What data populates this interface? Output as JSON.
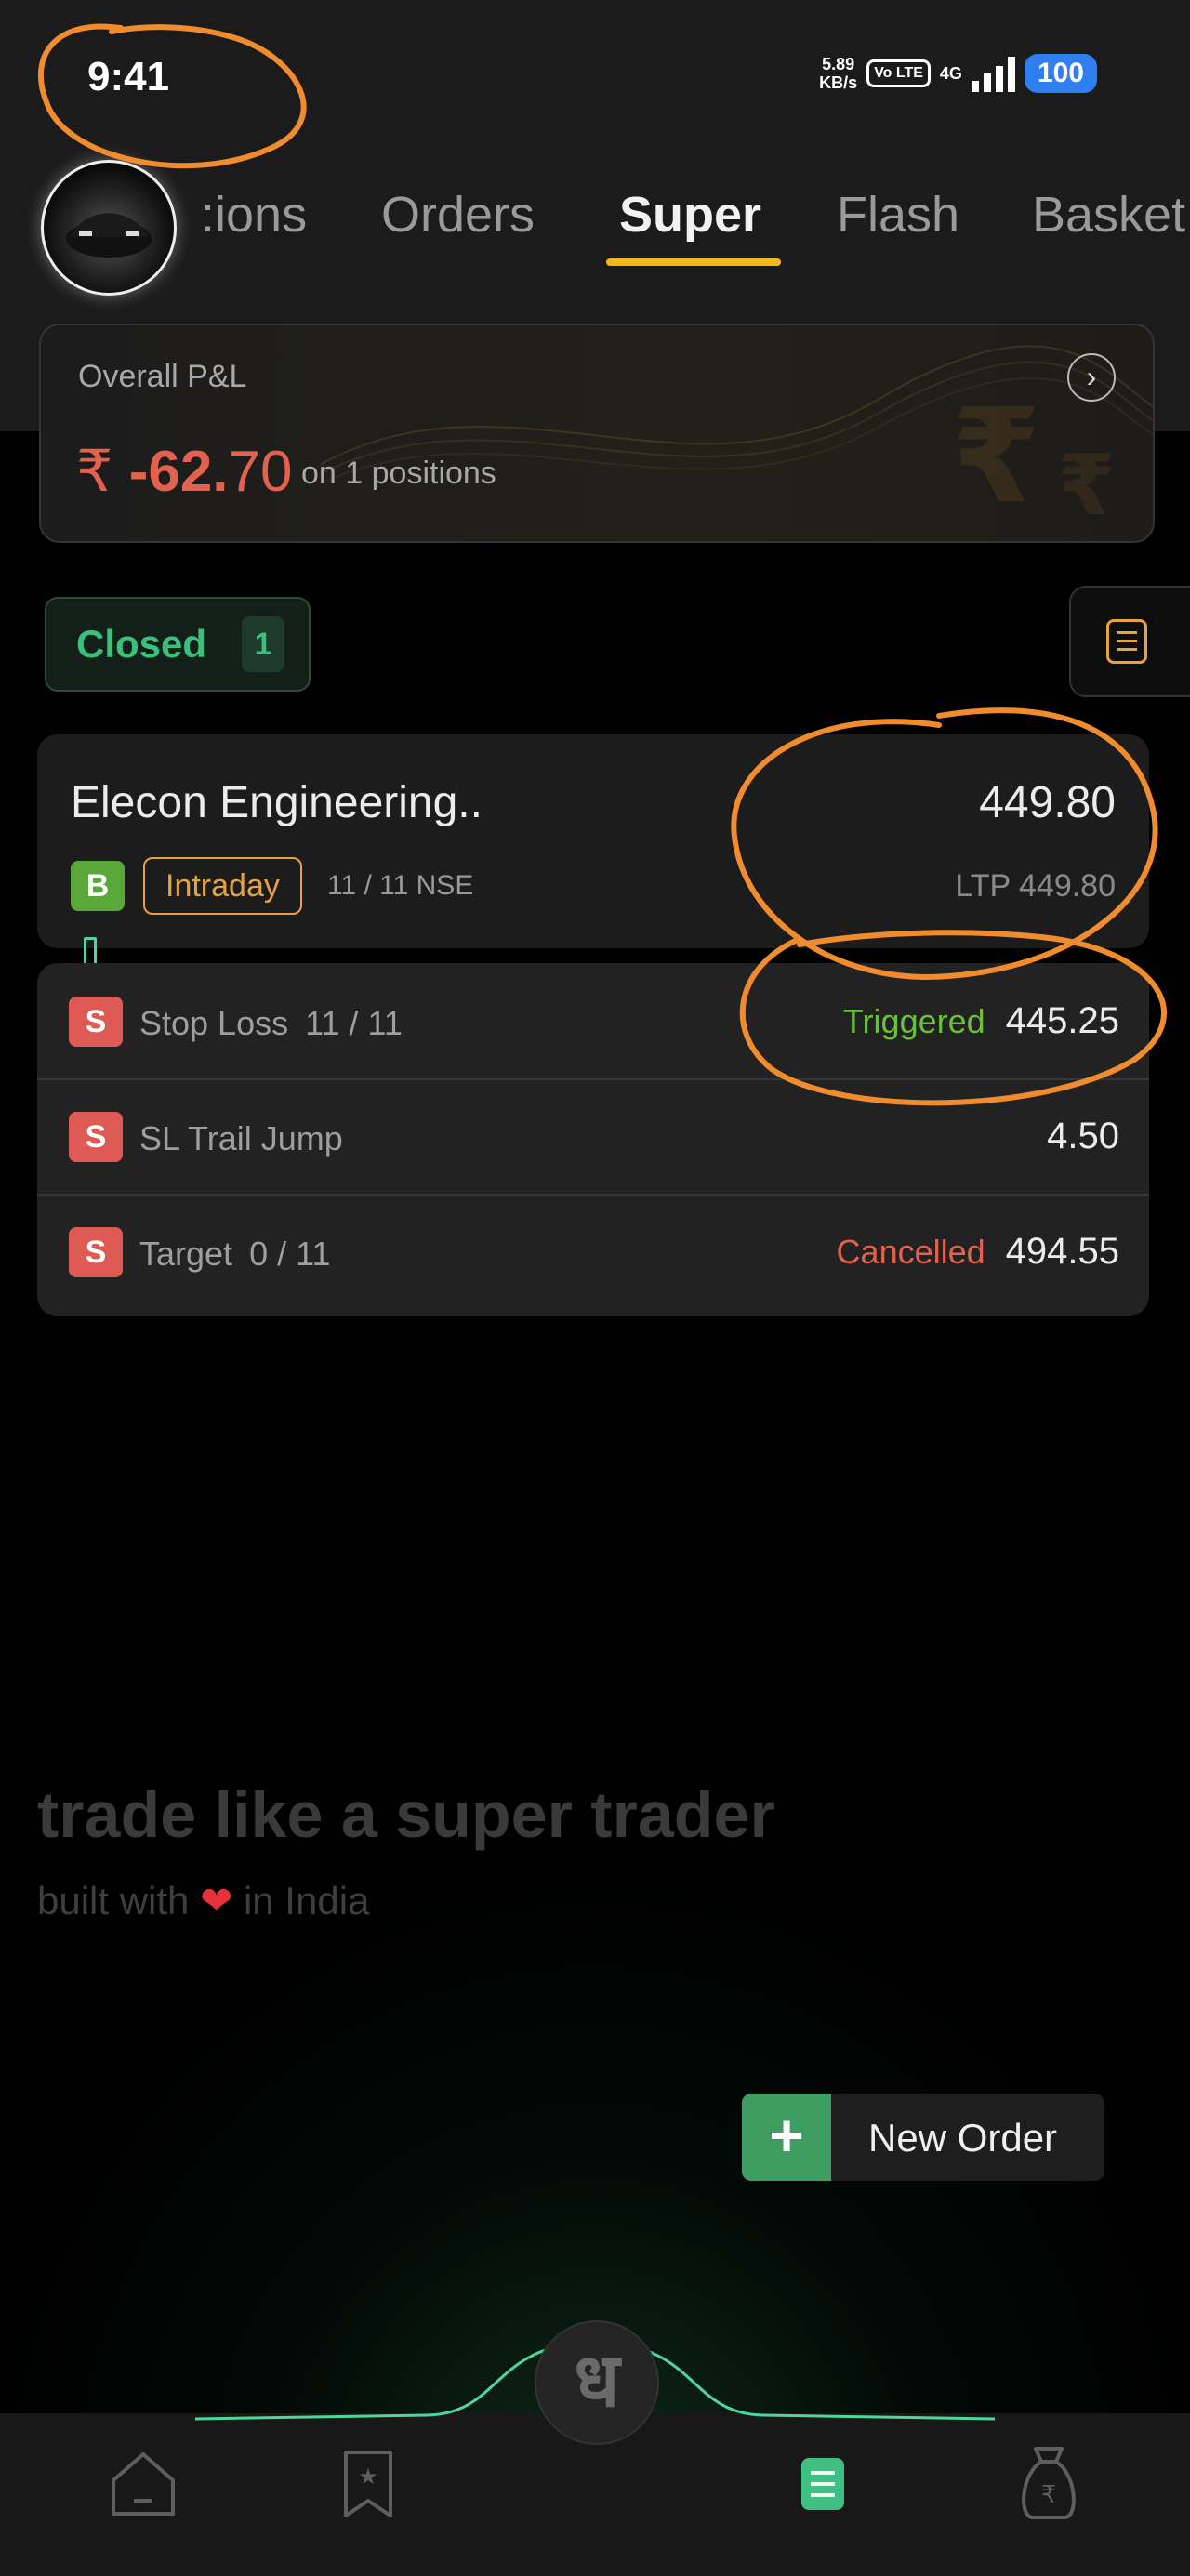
{
  "status_bar": {
    "time": "9:41",
    "speed_value": "5.89",
    "speed_unit": "KB/s",
    "volte": "Vo LTE",
    "network": "4G",
    "battery": "100"
  },
  "tabs": [
    {
      "label": ":ions",
      "active": false
    },
    {
      "label": "Orders",
      "active": false
    },
    {
      "label": "Super",
      "active": true
    },
    {
      "label": "Flash",
      "active": false
    },
    {
      "label": "Basket",
      "active": false
    }
  ],
  "pnl": {
    "label": "Overall P&L",
    "currency": "₹",
    "value_int": "-62.",
    "value_dec": "70",
    "subtitle": "on 1 positions"
  },
  "filter": {
    "label": "Closed",
    "count": "1"
  },
  "order": {
    "name": "Elecon Engineering..",
    "price": "449.80",
    "side": "B",
    "product": "Intraday",
    "qty": "11 / 11",
    "exchange": "NSE",
    "ltp_label": "LTP",
    "ltp_value": "449.80"
  },
  "legs": [
    {
      "side": "S",
      "label": "Stop Loss",
      "qty": "11 / 11",
      "status": "Triggered",
      "value": "445.25"
    },
    {
      "side": "S",
      "label": "SL Trail Jump",
      "qty": "",
      "status": "",
      "value": "4.50"
    },
    {
      "side": "S",
      "label": "Target",
      "qty": "0 / 11",
      "status": "Cancelled",
      "value": "494.55"
    }
  ],
  "footer": {
    "tagline": "trade like a super trader",
    "built_prefix": "built with",
    "built_suffix": "in India"
  },
  "new_order": {
    "label": "New Order"
  },
  "nav": {
    "center_glyph": "ध"
  },
  "colors": {
    "accent": "#f5b819",
    "loss": "#e2614f",
    "positive": "#39c07a",
    "annotation": "#f08c2e"
  }
}
